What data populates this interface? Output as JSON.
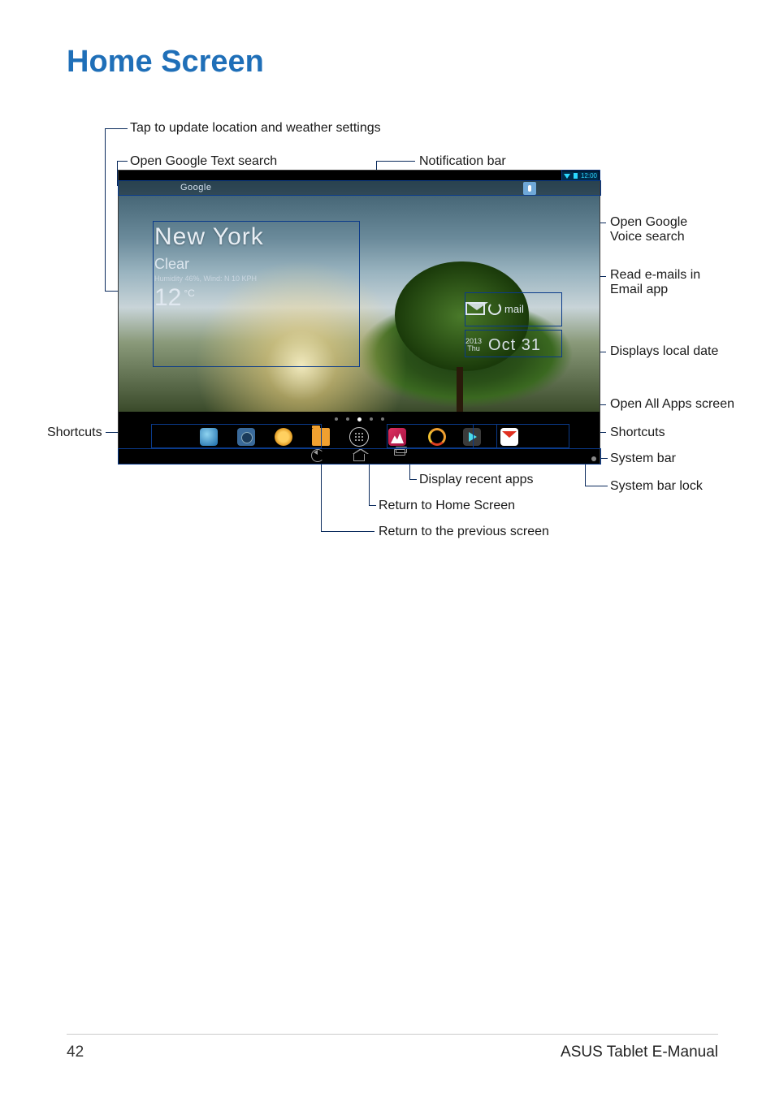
{
  "page": {
    "title": "Home Screen",
    "number": "42",
    "doc_title": "ASUS Tablet E-Manual"
  },
  "callouts": {
    "weather_settings": "Tap to update location and weather settings",
    "google_text": "Open Google Text search",
    "notification_bar": "Notification bar",
    "google_voice": "Open Google\nVoice search",
    "email": "Read e-mails in\nEmail app",
    "local_date": "Displays local date",
    "all_apps": "Open All Apps screen",
    "shortcuts_left": "Shortcuts",
    "shortcuts_right": "Shortcuts",
    "system_bar": "System bar",
    "system_bar_lock": "System bar lock",
    "recent_apps": "Display recent apps",
    "return_home": "Return to Home Screen",
    "return_previous": "Return to the previous screen"
  },
  "screen": {
    "status_time": "12:00",
    "search_brand": "Google",
    "weather": {
      "city": "New York",
      "condition": "Clear",
      "humidity_wind": "Humidity 46%, Wind: N 10 KPH",
      "temp": "12",
      "unit": "°C"
    },
    "email_label": "mail",
    "date": {
      "year": "2013",
      "day_name": "Thu",
      "date": "Oct 31"
    }
  }
}
